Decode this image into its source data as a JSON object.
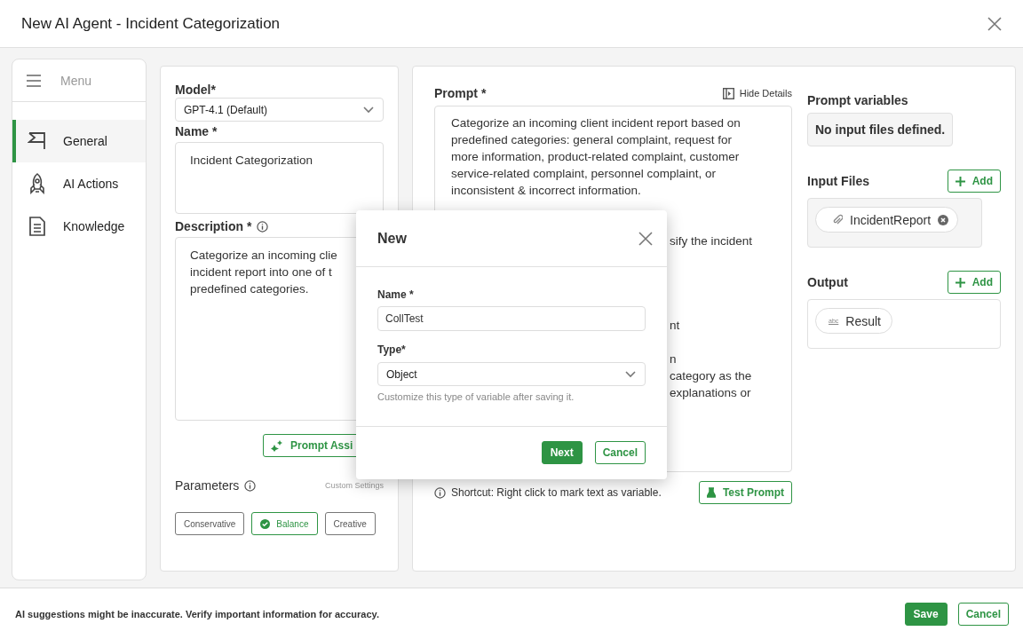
{
  "window": {
    "title": "New AI Agent - Incident Categorization"
  },
  "sidebar": {
    "menu_label": "Menu",
    "items": [
      {
        "label": "General",
        "selected": true
      },
      {
        "label": "AI Actions",
        "selected": false
      },
      {
        "label": "Knowledge",
        "selected": false
      }
    ]
  },
  "general": {
    "model_label": "Model*",
    "model_value": "GPT-4.1 (Default)",
    "name_label": "Name *",
    "name_value": "Incident Categorization",
    "description_label": "Description  *",
    "description_lines": [
      "Categorize an incoming clie",
      "incident report into one of t",
      "predefined categories."
    ],
    "prompt_assist": "Prompt Assi",
    "parameters_label": "Parameters",
    "custom_settings": "Custom Settings",
    "parameters": [
      {
        "label": "Conservative",
        "selected": false
      },
      {
        "label": "Balance",
        "selected": true
      },
      {
        "label": "Creative",
        "selected": false
      }
    ]
  },
  "prompt": {
    "label": "Prompt *",
    "hide_details": "Hide Details",
    "text": "Categorize an incoming client incident report based on predefined categories: general complaint, request for more information, product-related complaint, customer service-related complaint, personnel complaint, or inconsistent & incorrect information.",
    "fragments": [
      "sify the incident",
      "nt",
      "n",
      "category as the",
      "explanations or"
    ],
    "shortcut": "Shortcut: Right click to mark text as variable.",
    "test_button": "Test Prompt"
  },
  "variables": {
    "label": "Prompt variables",
    "empty": "No input files defined."
  },
  "input_files": {
    "label": "Input Files",
    "add": "Add",
    "items": [
      {
        "name": "IncidentReport"
      }
    ]
  },
  "output": {
    "label": "Output",
    "add": "Add",
    "items": [
      {
        "type_label": "abc",
        "name": "Result"
      }
    ]
  },
  "dialog": {
    "title": "New",
    "name_label": "Name *",
    "name_value": "CollTest",
    "type_label": "Type*",
    "type_value": "Object",
    "hint": "Customize this type of variable after saving it.",
    "primary": "Next",
    "secondary": "Cancel"
  },
  "footer": {
    "notice": "AI suggestions might be inaccurate. Verify important information for accuracy.",
    "save": "Save",
    "cancel": "Cancel"
  }
}
